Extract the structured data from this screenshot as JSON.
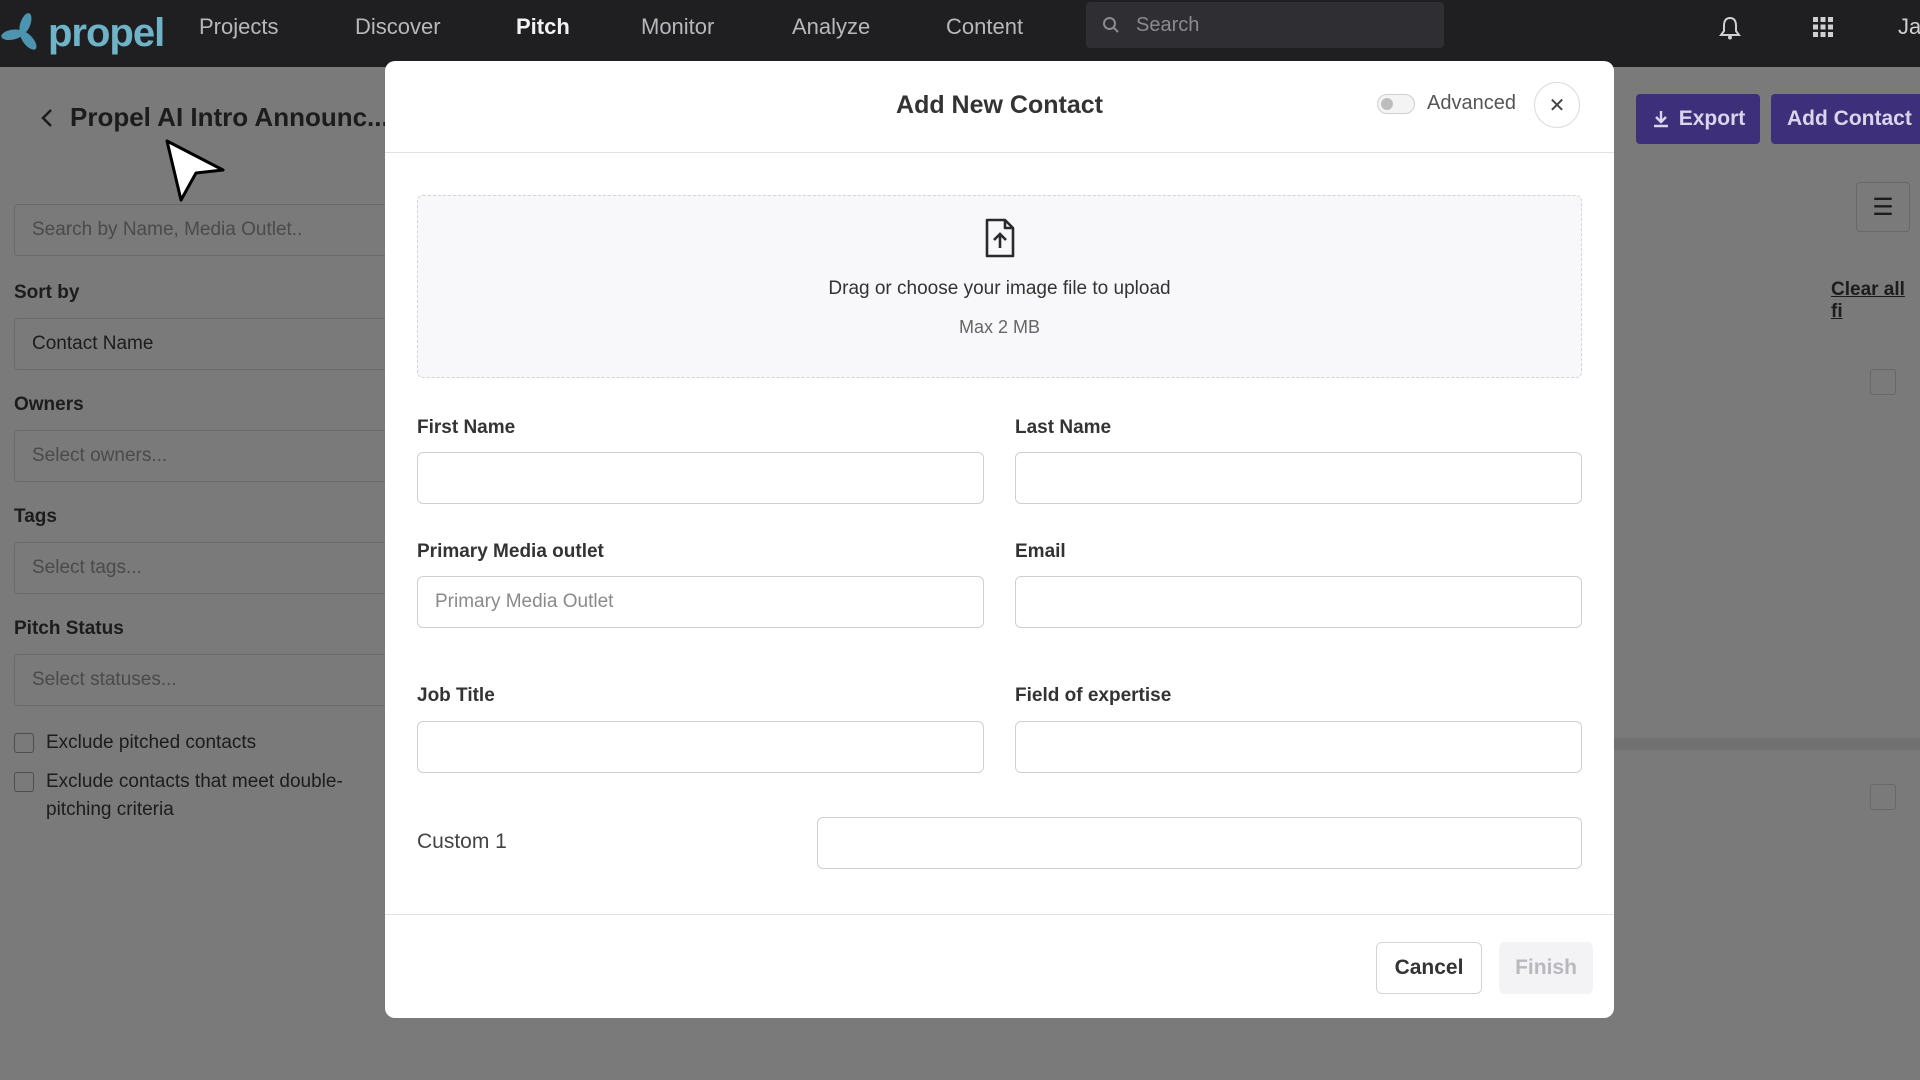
{
  "nav": {
    "logo": "propel",
    "items": [
      "Projects",
      "Discover",
      "Pitch",
      "Monitor",
      "Analyze",
      "Content"
    ],
    "active": "Pitch",
    "search_placeholder": "Search",
    "user_initials": "Ja"
  },
  "page": {
    "title": "Propel AI Intro Announc...",
    "export_label": "Export",
    "add_contact_label": "Add Contact",
    "clear_all": "Clear all fi"
  },
  "filters": {
    "search_placeholder": "Search by Name, Media Outlet..",
    "sort_by_label": "Sort by",
    "sort_by_value": "Contact Name",
    "owners_label": "Owners",
    "owners_placeholder": "Select owners...",
    "tags_label": "Tags",
    "tags_placeholder": "Select tags...",
    "pitch_status_label": "Pitch Status",
    "pitch_status_placeholder": "Select statuses...",
    "exclude_pitched": "Exclude pitched contacts",
    "exclude_double_1": "Exclude contacts that meet double-",
    "exclude_double_2": "pitching criteria"
  },
  "modal": {
    "title": "Add New Contact",
    "advanced_label": "Advanced",
    "advanced_on": false,
    "upload_text": "Drag or choose your image file to upload",
    "upload_limit": "Max 2 MB",
    "fields": {
      "first_name": {
        "label": "First Name",
        "value": "",
        "placeholder": ""
      },
      "last_name": {
        "label": "Last Name",
        "value": "",
        "placeholder": ""
      },
      "media_outlet": {
        "label": "Primary Media outlet",
        "value": "",
        "placeholder": "Primary Media Outlet"
      },
      "email": {
        "label": "Email",
        "value": "",
        "placeholder": ""
      },
      "job_title": {
        "label": "Job Title",
        "value": "",
        "placeholder": ""
      },
      "expertise": {
        "label": "Field of expertise",
        "value": "",
        "placeholder": ""
      },
      "custom1": {
        "label": "Custom 1",
        "value": "",
        "placeholder": ""
      }
    },
    "cancel_label": "Cancel",
    "finish_label": "Finish"
  },
  "colors": {
    "brand": "#3d2f7a",
    "nav_bg": "#1f1f22",
    "logo": "#6fb3c8"
  }
}
